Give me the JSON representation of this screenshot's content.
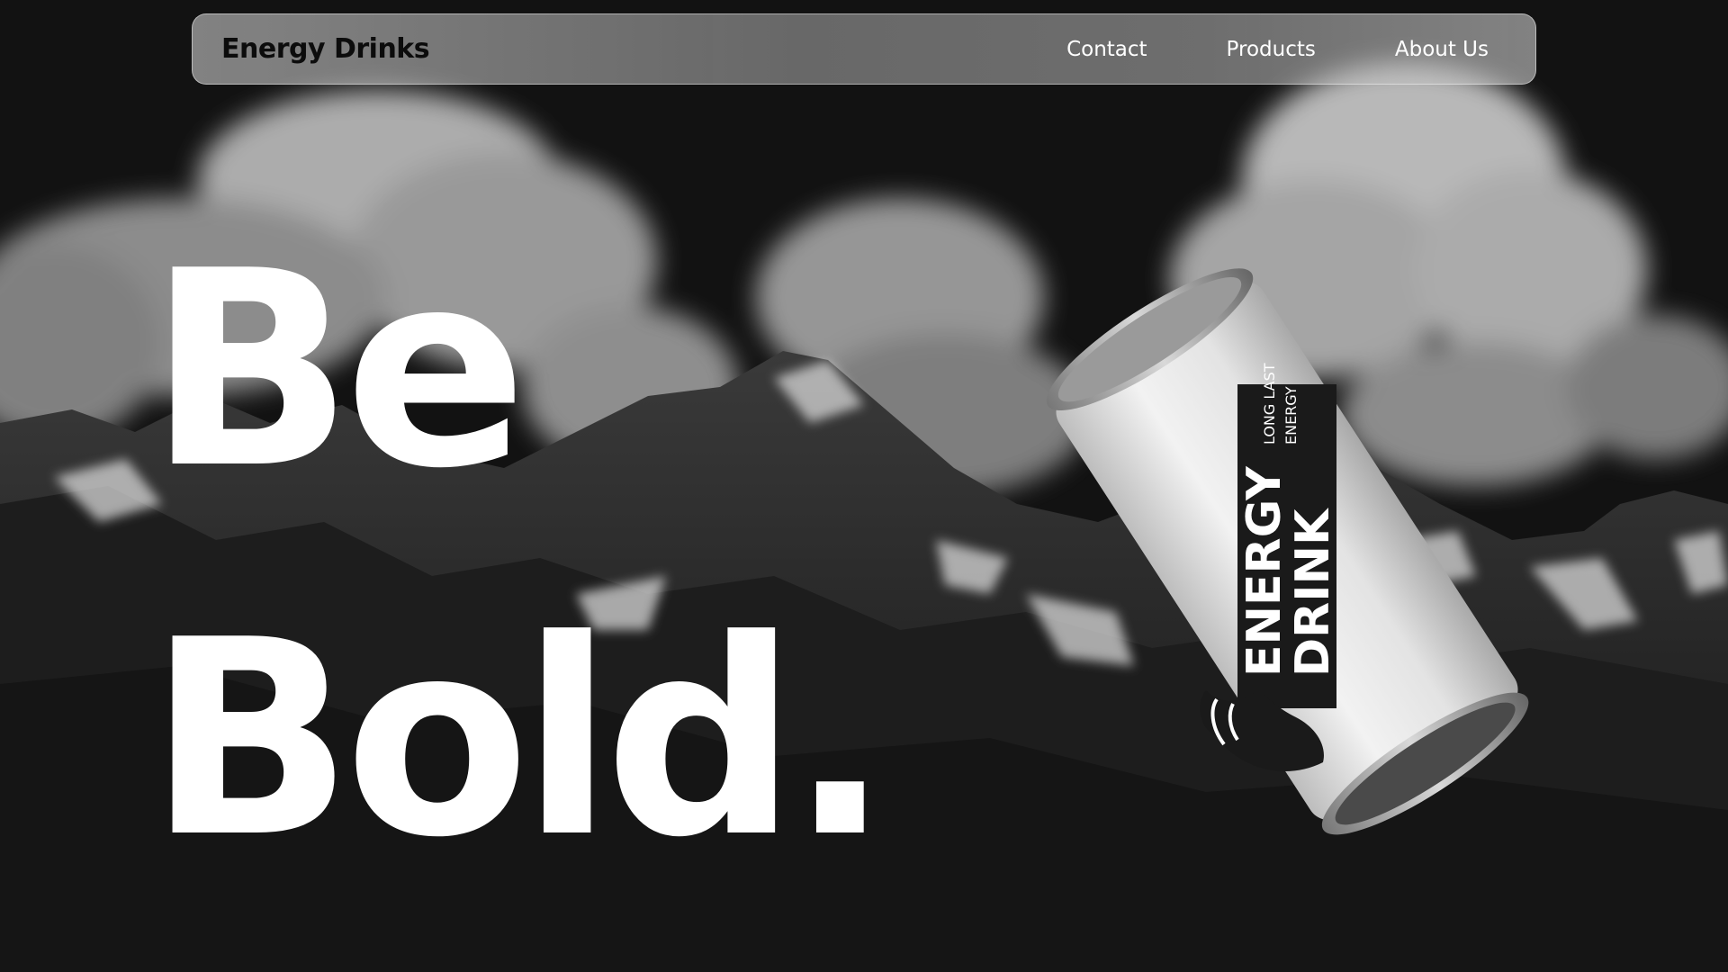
{
  "nav": {
    "brand": "Energy Drinks",
    "links": [
      "Contact",
      "Products",
      "About Us"
    ]
  },
  "hero": {
    "line1": "Be",
    "line2": "Bold.",
    "background": "black-and-white mountain range with clouds"
  },
  "can": {
    "label_line1": "ENERGY",
    "label_line2": "DRINK",
    "tagline_line1": "LONG LAST",
    "tagline_line2": "ENERGY",
    "logo": "horse-head-icon"
  },
  "colors": {
    "background": "#121212",
    "text": "#ffffff",
    "brand_text": "#0c0c0c"
  }
}
